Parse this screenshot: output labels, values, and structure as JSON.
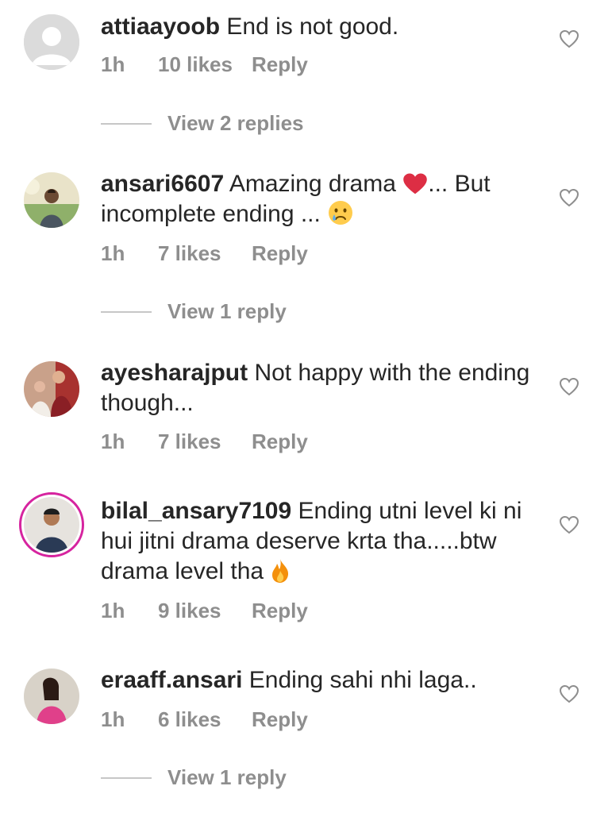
{
  "comments": [
    {
      "username": "attiaayoob",
      "text": "End is not good.",
      "time": "1h",
      "likes": "10 likes",
      "reply": "Reply",
      "avatar": "default-avatar",
      "view_replies": "View 2 replies"
    },
    {
      "username": "ansari6607",
      "text_before": "Amazing drama",
      "text_after": "... But incomplete ending ...",
      "emoji_1": "red-heart-icon",
      "emoji_2": "crying-face-icon",
      "time": "1h",
      "likes": "7 likes",
      "reply": "Reply",
      "view_replies": "View 1 reply"
    },
    {
      "username": "ayesharajput",
      "text": "Not happy with the ending though...",
      "time": "1h",
      "likes": "7 likes",
      "reply": "Reply"
    },
    {
      "username": "bilal_ansary7109",
      "text": "Ending utni level ki ni hui jitni drama deserve krta tha.....btw drama level tha",
      "emoji": "fire-icon",
      "time": "1h",
      "likes": "9 likes",
      "reply": "Reply",
      "story_ring_color": "#d6249f"
    },
    {
      "username": "eraaff.ansari",
      "text": "Ending sahi nhi laga..",
      "time": "1h",
      "likes": "6 likes",
      "reply": "Reply",
      "view_replies": "View 1 reply"
    }
  ],
  "colors": {
    "primary_text": "#262626",
    "secondary_text": "#8e8e8e",
    "divider": "#c7c7c7",
    "heart_outline": "#8e8e8e"
  }
}
